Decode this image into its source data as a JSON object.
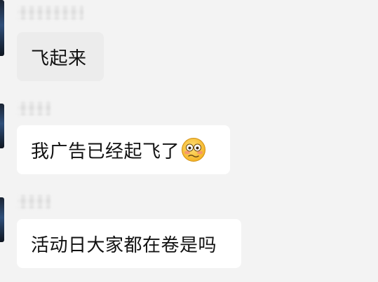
{
  "messages": [
    {
      "sender": "",
      "text": "飞起来",
      "emoji": null
    },
    {
      "sender": "",
      "text": "我广告已经起飞了",
      "emoji": "flushed-face-icon"
    },
    {
      "sender": "",
      "text": "活动日大家都在卷是吗",
      "emoji": null
    }
  ],
  "colors": {
    "background": "#f3f3f3",
    "bubble": "#ffffff",
    "bubble_highlight": "#ececec",
    "text": "#111111"
  }
}
